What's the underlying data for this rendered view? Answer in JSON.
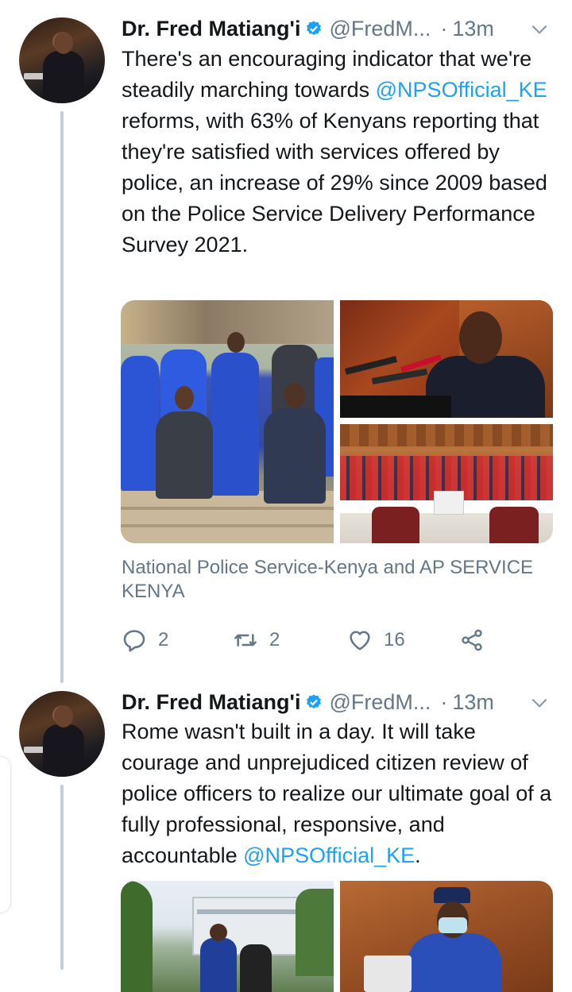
{
  "tweets": [
    {
      "author": {
        "name": "Dr. Fred Matiang'i",
        "handle": "@FredM...",
        "time": "13m",
        "separator": "·"
      },
      "text": {
        "part1": "There's an encouraging indicator that we're steadily marching towards ",
        "mention": "@NPSOfficial_KE",
        "part2": "  reforms, with 63% of Kenyans reporting  that they're satisfied with services offered by police, an increase of 29% since 2009 based on the Police Service Delivery Performance Survey 2021."
      },
      "media_tags": "National Police Service-Kenya and AP SERVICE KENYA",
      "stats": {
        "replies": "2",
        "retweets": "2",
        "likes": "16"
      }
    },
    {
      "author": {
        "name": "Dr. Fred Matiang'i",
        "handle": "@FredM...",
        "time": "13m",
        "separator": "·"
      },
      "text": {
        "part1": "Rome wasn't built in a day. It will take courage and unprejudiced citizen review of police officers to realize our ultimate goal of a fully professional, responsive, and accountable ",
        "mention": "@NPSOfficial_KE",
        "part2": "."
      }
    }
  ],
  "colors": {
    "text": "#14171a",
    "secondary": "#657786",
    "link": "#1da1f2",
    "verified": "#1da1f2",
    "thread_line": "#c4cfd6",
    "police_uniform": "#1f4fd1"
  },
  "icons": {
    "reply": "reply-icon",
    "retweet": "retweet-icon",
    "like": "heart-icon",
    "share": "share-icon",
    "verified": "verified-badge-icon",
    "menu": "chevron-down-icon"
  }
}
